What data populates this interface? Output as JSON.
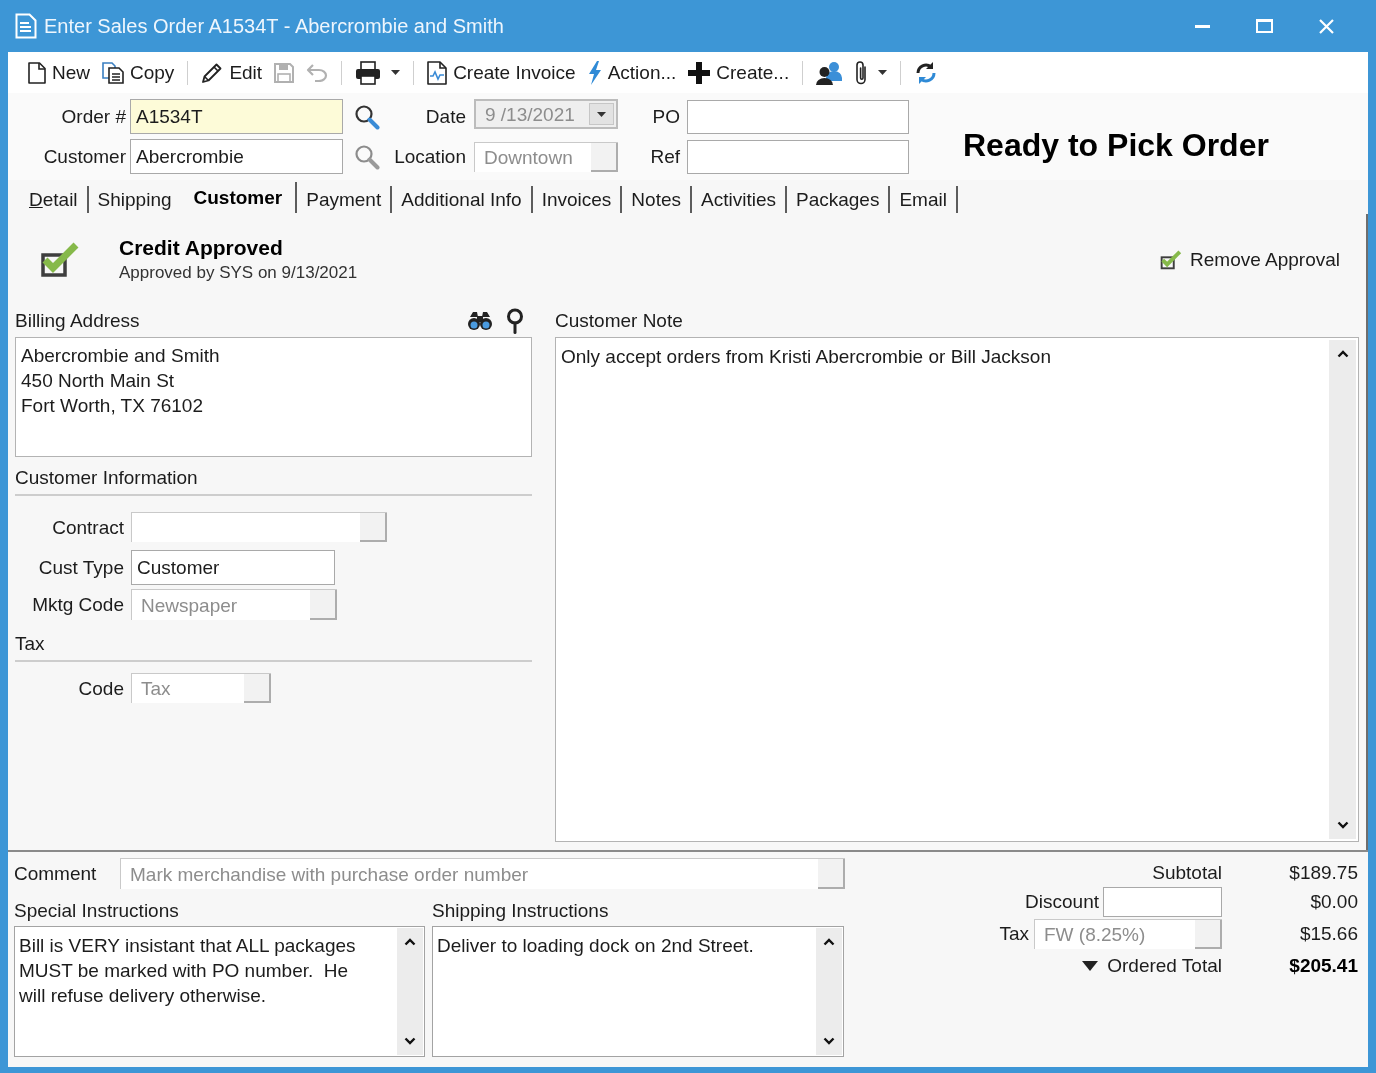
{
  "window": {
    "title": "Enter Sales Order A1534T - Abercrombie and Smith"
  },
  "toolbar": [
    {
      "kind": "button",
      "label": "New",
      "disabled": false
    },
    {
      "kind": "button",
      "label": "Copy",
      "disabled": false
    },
    {
      "kind": "separator"
    },
    {
      "kind": "button",
      "label": "Edit",
      "disabled": false
    },
    {
      "kind": "button",
      "disabled": true
    },
    {
      "kind": "button",
      "disabled": true
    },
    {
      "kind": "separator"
    },
    {
      "kind": "button",
      "disabled": false,
      "dropdown": true
    },
    {
      "kind": "separator"
    },
    {
      "kind": "button",
      "label": "Create Invoice",
      "disabled": false
    },
    {
      "kind": "button",
      "label": "Action...",
      "disabled": false
    },
    {
      "kind": "button",
      "label": "Create...",
      "disabled": false
    },
    {
      "kind": "separator"
    },
    {
      "kind": "button",
      "disabled": false
    },
    {
      "kind": "button",
      "disabled": false,
      "dropdown": true
    },
    {
      "kind": "separator"
    },
    {
      "kind": "button",
      "disabled": false
    }
  ],
  "header": {
    "order": {
      "label": "Order #",
      "value": "A1534T",
      "highlighted": true
    },
    "customer": {
      "label": "Customer",
      "value": "Abercrombie",
      "highlighted": false
    },
    "date": {
      "label": "Date",
      "kind": "date",
      "value": "9 /13/2021",
      "disabled": true
    },
    "location": {
      "label": "Location",
      "kind": "combo",
      "value": "Downtown",
      "disabled": true
    },
    "po": {
      "label": "PO"
    },
    "ref": {
      "label": "Ref"
    },
    "status": "Ready to Pick Order"
  },
  "tabs": [
    {
      "label": "Detail",
      "selected": false,
      "mnemonic": true
    },
    {
      "label": "Shipping",
      "selected": false
    },
    {
      "label": "Customer",
      "selected": true
    },
    {
      "label": "Payment",
      "selected": false
    },
    {
      "label": "Additional Info",
      "selected": false
    },
    {
      "label": "Invoices",
      "selected": false
    },
    {
      "label": "Notes",
      "selected": false
    },
    {
      "label": "Activities",
      "selected": false
    },
    {
      "label": "Packages",
      "selected": false
    },
    {
      "label": "Email",
      "selected": false
    }
  ],
  "credit": {
    "title": "Credit Approved",
    "detail": "Approved by SYS on 9/13/2021",
    "action": "Remove Approval"
  },
  "billing_address": {
    "label": "Billing Address",
    "value": "Abercrombie and Smith\n450 North Main St\nFort Worth, TX 76102"
  },
  "customer_information": {
    "title": "Customer Information",
    "fields": [
      {
        "label": "Contract",
        "kind": "combo"
      },
      {
        "label": "Cust Type",
        "kind": "text",
        "value": "Customer"
      },
      {
        "label": "Mktg Code",
        "kind": "combo",
        "value": "Newspaper",
        "disabled": true
      }
    ]
  },
  "tax": {
    "title": "Tax",
    "fields": [
      {
        "label": "Code",
        "kind": "combo",
        "value": "Tax",
        "disabled": true
      }
    ]
  },
  "customer_note": {
    "label": "Customer Note",
    "value": "Only accept orders from Kristi Abercrombie or Bill Jackson"
  },
  "comment": {
    "label": "Comment",
    "kind": "combo",
    "value": "Mark merchandise with purchase order number",
    "disabled": true
  },
  "special_instructions": {
    "label": "Special Instructions",
    "value": "Bill is VERY insistant that ALL packages MUST be marked with PO number.  He will refuse delivery otherwise."
  },
  "shipping_instructions": {
    "label": "Shipping Instructions",
    "value": "Deliver to loading dock on 2nd Street."
  },
  "totals": [
    {
      "kind": "plain",
      "label": "Subtotal",
      "value": "$189.75"
    },
    {
      "kind": "input",
      "label": "Discount",
      "value": "$0.00"
    },
    {
      "kind": "combo",
      "label": "Tax",
      "input_value": "FW (8.25%)",
      "value": "$15.66",
      "disabled": true
    },
    {
      "kind": "total",
      "label": "Ordered Total",
      "value": "$205.41"
    }
  ]
}
